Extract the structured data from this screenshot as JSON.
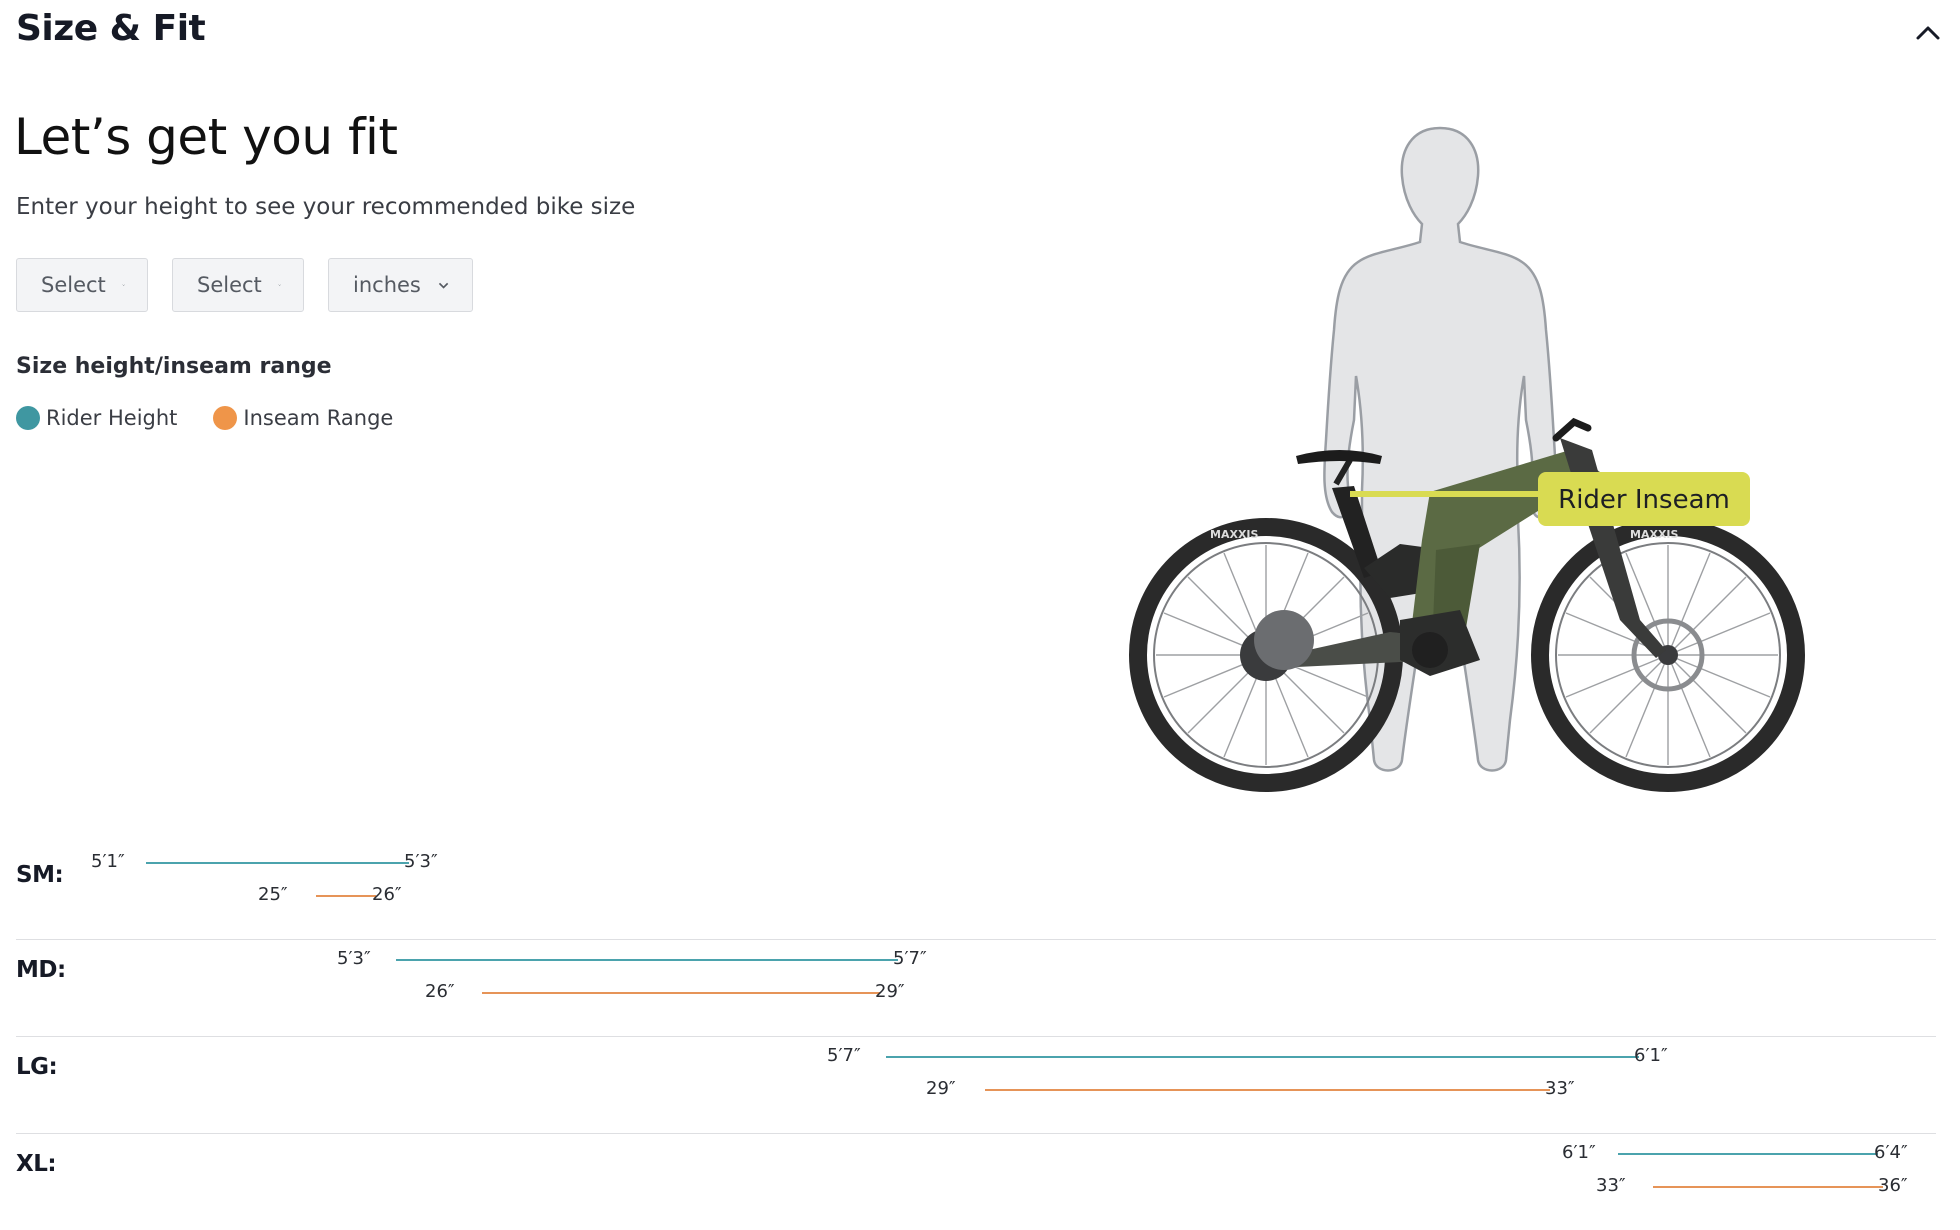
{
  "section": {
    "title": "Size & Fit"
  },
  "hero": {
    "headline": "Let’s get you fit",
    "subhead": "Enter your height to see your recommended bike size",
    "inseam_callout": "Rider Inseam",
    "tire_brand": "MAXXIS"
  },
  "selects": [
    {
      "value": "Select"
    },
    {
      "value": "Select"
    },
    {
      "value": "inches"
    }
  ],
  "ranges": {
    "title": "Size height/inseam range",
    "legend": [
      {
        "label": "Rider Height",
        "color": "#3f97a1"
      },
      {
        "label": "Inseam Range",
        "color": "#ef9549"
      }
    ]
  },
  "colors": {
    "height_line": "#4ba3ad",
    "inseam_line": "#e69458",
    "callout": "#d9db52"
  },
  "sizes": [
    {
      "label": "SM:",
      "height_min": "5′1″",
      "height_max": "5′3″",
      "inseam_min": "25″",
      "inseam_max": "26″"
    },
    {
      "label": "MD:",
      "height_min": "5′3″",
      "height_max": "5′7″",
      "inseam_min": "26″",
      "inseam_max": "29″"
    },
    {
      "label": "LG:",
      "height_min": "5′7″",
      "height_max": "6′1″",
      "inseam_min": "29″",
      "inseam_max": "33″"
    },
    {
      "label": "XL:",
      "height_min": "6′1″",
      "height_max": "6′4″",
      "inseam_min": "33″",
      "inseam_max": "36″"
    }
  ]
}
